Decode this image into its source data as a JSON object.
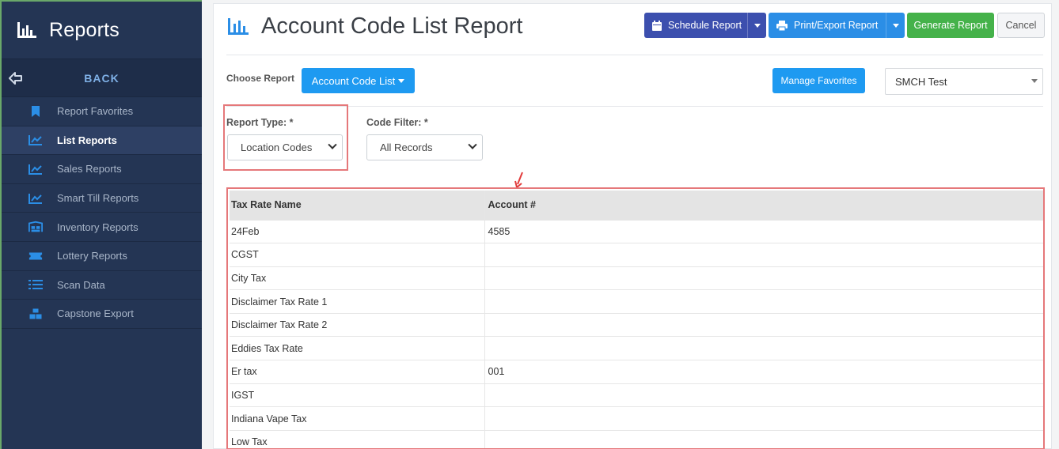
{
  "sidebar": {
    "title": "Reports",
    "back_label": "BACK",
    "items": [
      {
        "label": "Report Favorites",
        "icon": "bookmark-icon",
        "active": false
      },
      {
        "label": "List Reports",
        "icon": "trend-chart-icon",
        "active": true
      },
      {
        "label": "Sales Reports",
        "icon": "trend-chart-icon",
        "active": false
      },
      {
        "label": "Smart Till Reports",
        "icon": "trend-chart-icon",
        "active": false
      },
      {
        "label": "Inventory Reports",
        "icon": "warehouse-icon",
        "active": false
      },
      {
        "label": "Lottery Reports",
        "icon": "ticket-icon",
        "active": false
      },
      {
        "label": "Scan Data",
        "icon": "list-icon",
        "active": false
      },
      {
        "label": "Capstone Export",
        "icon": "cubes-icon",
        "active": false
      }
    ]
  },
  "header": {
    "title": "Account Code List Report",
    "schedule_label": "Schedule Report",
    "print_label": "Print/Export Report",
    "generate_label": "Generate Report",
    "cancel_label": "Cancel"
  },
  "toolbar": {
    "choose_label": "Choose Report",
    "report_button": "Account Code List",
    "favorites_button": "Manage Favorites",
    "store_value": "SMCH Test"
  },
  "filters": {
    "report_type_label": "Report Type: *",
    "report_type_value": "Location Codes",
    "code_filter_label": "Code Filter: *",
    "code_filter_value": "All Records"
  },
  "table": {
    "headers": [
      "Tax Rate Name",
      "Account #"
    ],
    "rows": [
      [
        "24Feb",
        "4585"
      ],
      [
        "CGST",
        ""
      ],
      [
        "City Tax",
        ""
      ],
      [
        "Disclaimer Tax Rate 1",
        ""
      ],
      [
        "Disclaimer Tax Rate 2",
        ""
      ],
      [
        "Eddies Tax Rate",
        ""
      ],
      [
        "Er tax",
        "001"
      ],
      [
        "IGST",
        ""
      ],
      [
        "Indiana Vape Tax",
        ""
      ],
      [
        "Low Tax",
        ""
      ]
    ]
  },
  "colors": {
    "sidebar_bg": "#243554",
    "accent_blue": "#1e9af1",
    "schedule_btn": "#3c4fae",
    "generate_btn": "#45b24a",
    "highlight_red": "#e5787a"
  }
}
